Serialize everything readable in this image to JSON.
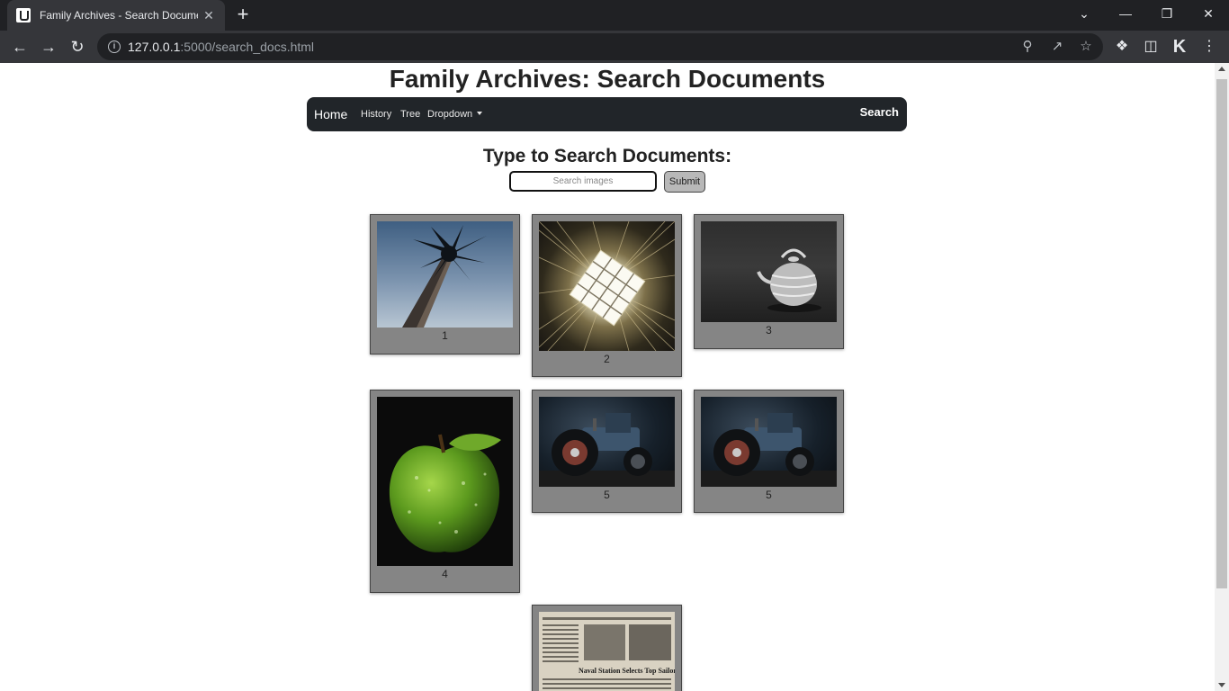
{
  "browser": {
    "tab_title": "Family Archives - Search Documents",
    "tab_close": "✕",
    "new_tab": "+",
    "url_host": "127.0.0.1",
    "url_rest": ":5000/search_docs.html"
  },
  "page": {
    "title": "Family Archives: Search Documents",
    "search_heading": "Type to Search Documents:",
    "search_placeholder": "Search images",
    "submit_label": "Submit"
  },
  "navbar": {
    "brand": "Home",
    "links": [
      "History",
      "Tree",
      "Dropdown"
    ],
    "search": "Search"
  },
  "cards": [
    {
      "label": "1",
      "icon": "palm-tree-photo"
    },
    {
      "label": "2",
      "icon": "light-grid-photo"
    },
    {
      "label": "3",
      "icon": "teapot-photo"
    },
    {
      "label": "4",
      "icon": "green-apple-photo"
    },
    {
      "label": "5",
      "icon": "tractor-photo"
    },
    {
      "label": "5",
      "icon": "tractor-photo"
    },
    {
      "label": "",
      "icon": "newspaper-clipping-photo",
      "headline": "Naval Station Selects Top Sailors"
    }
  ]
}
